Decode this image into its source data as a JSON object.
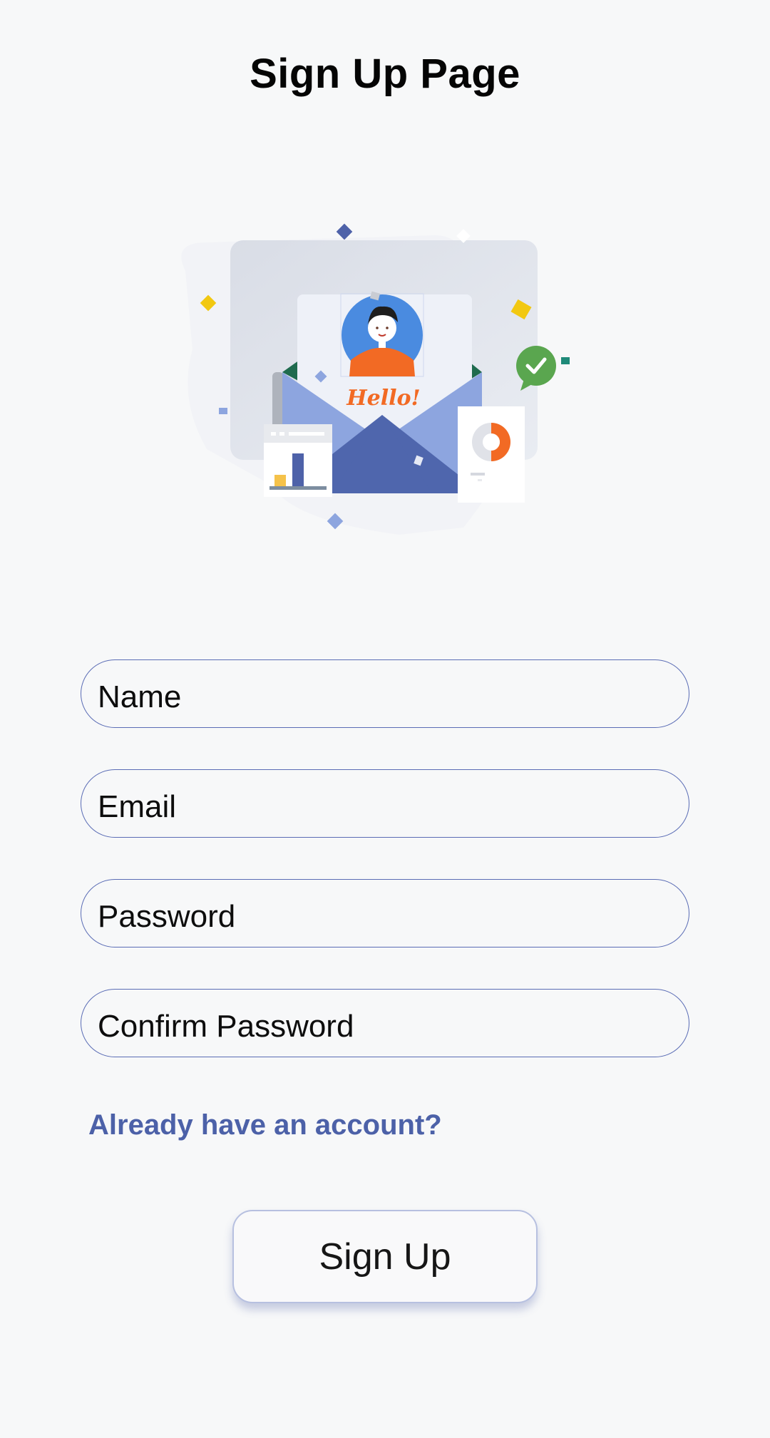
{
  "header": {
    "title": "Sign Up Page"
  },
  "illustration": {
    "greeting": "Hello!",
    "icon": "mail-envelope-illustration"
  },
  "form": {
    "name_placeholder": "Name",
    "email_placeholder": "Email",
    "password_placeholder": "Password",
    "confirm_password_placeholder": "Confirm Password",
    "login_link": "Already have an account?",
    "submit_label": "Sign Up"
  },
  "colors": {
    "accent": "#4c61a8",
    "field_border": "#5a6cb5",
    "background": "#f7f8f9"
  }
}
